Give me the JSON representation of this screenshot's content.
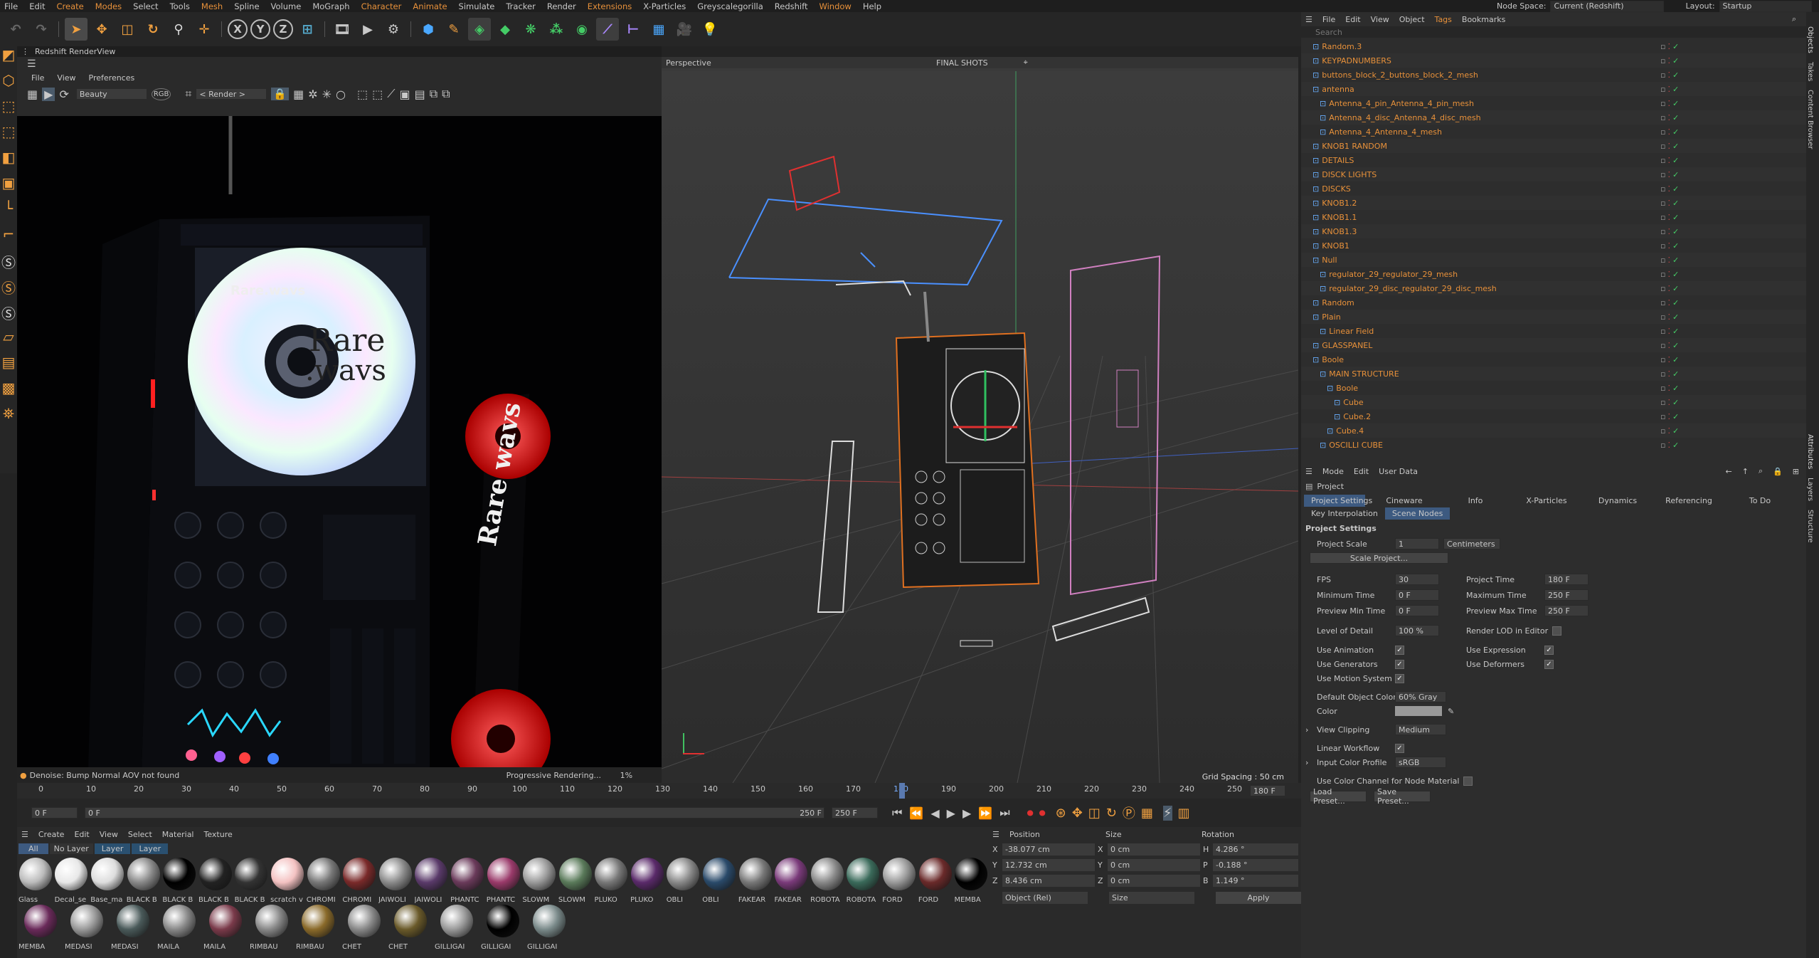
{
  "menubar": {
    "items": [
      "File",
      "Edit",
      "Create",
      "Modes",
      "Select",
      "Tools",
      "Mesh",
      "Spline",
      "Volume",
      "MoGraph",
      "Character",
      "Animate",
      "Simulate",
      "Tracker",
      "Render",
      "Extensions",
      "X-Particles",
      "Greyscalegorilla",
      "Redshift",
      "Window",
      "Help"
    ],
    "node_space_label": "Node Space:",
    "node_space_value": "Current (Redshift)",
    "layout_label": "Layout:",
    "layout_value": "Startup"
  },
  "toolbar": {
    "axis_x": "X",
    "axis_y": "Y",
    "axis_z": "Z"
  },
  "renderview": {
    "title": "Redshift RenderView",
    "menu": [
      "File",
      "View",
      "Preferences"
    ],
    "aov": "Beauty",
    "render_select": "< Render >",
    "status_left": "Denoise: Bump Normal AOV not found",
    "status_mid": "Progressive Rendering...",
    "status_pct": "1%",
    "device_brand": "Rare.wavs",
    "cd_text_1": "Rare",
    "cd_text_2": ".wavs",
    "side_text": "Rare wavs"
  },
  "viewport": {
    "name": "Perspective",
    "camera": "FINAL SHOTS",
    "grid_spacing": "Grid Spacing : 50 cm"
  },
  "objects_panel": {
    "menu": [
      "File",
      "Edit",
      "View",
      "Object",
      "Tags",
      "Bookmarks"
    ],
    "search_placeholder": "Search",
    "items": [
      {
        "name": "Random.3",
        "indent": 1
      },
      {
        "name": "KEYPADNUMBERS",
        "indent": 1
      },
      {
        "name": "buttons_block_2_buttons_block_2_mesh",
        "indent": 1
      },
      {
        "name": "antenna",
        "indent": 1
      },
      {
        "name": "Antenna_4_pin_Antenna_4_pin_mesh",
        "indent": 2
      },
      {
        "name": "Antenna_4_disc_Antenna_4_disc_mesh",
        "indent": 2
      },
      {
        "name": "Antenna_4_Antenna_4_mesh",
        "indent": 2
      },
      {
        "name": "KNOB1 RANDOM",
        "indent": 1
      },
      {
        "name": "DETAILS",
        "indent": 1
      },
      {
        "name": "DISCK LIGHTS",
        "indent": 1
      },
      {
        "name": "DISCKS",
        "indent": 1
      },
      {
        "name": "KNOB1.2",
        "indent": 1
      },
      {
        "name": "KNOB1.1",
        "indent": 1
      },
      {
        "name": "KNOB1.3",
        "indent": 1
      },
      {
        "name": "KNOB1",
        "indent": 1
      },
      {
        "name": "Null",
        "indent": 1
      },
      {
        "name": "regulator_29_regulator_29_mesh",
        "indent": 2
      },
      {
        "name": "regulator_29_disc_regulator_29_disc_mesh",
        "indent": 2
      },
      {
        "name": "Random",
        "indent": 1
      },
      {
        "name": "Plain",
        "indent": 1
      },
      {
        "name": "Linear Field",
        "indent": 2
      },
      {
        "name": "GLASSPANEL",
        "indent": 1
      },
      {
        "name": "Boole",
        "indent": 1
      },
      {
        "name": "MAIN STRUCTURE",
        "indent": 2
      },
      {
        "name": "Boole",
        "indent": 3
      },
      {
        "name": "Cube",
        "indent": 4
      },
      {
        "name": "Cube.2",
        "indent": 4
      },
      {
        "name": "Cube.4",
        "indent": 3
      },
      {
        "name": "OSCILLI CUBE",
        "indent": 2
      }
    ]
  },
  "attributes": {
    "menu": [
      "Mode",
      "Edit",
      "User Data"
    ],
    "title": "Project",
    "tabs": [
      "Project Settings",
      "Cineware",
      "Info",
      "X-Particles",
      "Dynamics",
      "Referencing",
      "To Do"
    ],
    "subtabs": [
      "Key Interpolation",
      "Scene Nodes"
    ],
    "section": "Project Settings",
    "project_scale_label": "Project Scale",
    "project_scale_value": "1",
    "project_scale_unit": "Centimeters",
    "scale_button": "Scale Project...",
    "fps_label": "FPS",
    "fps": "30",
    "project_time_label": "Project Time",
    "project_time": "180 F",
    "min_time_label": "Minimum Time",
    "min_time": "0 F",
    "max_time_label": "Maximum Time",
    "max_time": "250 F",
    "prev_min_label": "Preview Min Time",
    "prev_min": "0 F",
    "prev_max_label": "Preview Max Time",
    "prev_max": "250 F",
    "lod_label": "Level of Detail",
    "lod": "100 %",
    "render_lod_label": "Render LOD in Editor",
    "use_anim": "Use Animation",
    "use_expr": "Use Expression",
    "use_gen": "Use Generators",
    "use_def": "Use Deformers",
    "use_motion": "Use Motion System",
    "def_color_label": "Default Object Color",
    "def_color": "60% Gray",
    "color_label": "Color",
    "view_clip_label": "View Clipping",
    "view_clip": "Medium",
    "linear_label": "Linear Workflow",
    "input_profile_label": "Input Color Profile",
    "input_profile": "sRGB",
    "node_mat_label": "Use Color Channel for Node Material",
    "load_preset": "Load Preset...",
    "save_preset": "Save Preset..."
  },
  "timeline": {
    "ticks": [
      "0",
      "10",
      "20",
      "30",
      "40",
      "50",
      "60",
      "70",
      "80",
      "90",
      "100",
      "110",
      "120",
      "130",
      "140",
      "150",
      "160",
      "170",
      "180",
      "190",
      "200",
      "210",
      "220",
      "230",
      "240",
      "250"
    ],
    "current": "180 F",
    "start": "0 F",
    "start2": "0 F",
    "end": "250 F",
    "end2": "250 F"
  },
  "materials": {
    "menu": [
      "Create",
      "Edit",
      "View",
      "Select",
      "Material",
      "Texture"
    ],
    "filters": [
      "All",
      "No Layer",
      "Layer",
      "Layer"
    ],
    "row1": [
      "Glass",
      "Decal_se",
      "Base_ma",
      "BLACK B",
      "BLACK B",
      "BLACK B",
      "BLACK B",
      "scratch v",
      "CHROMI",
      "CHROMI",
      "JAIWOLI",
      "JAIWOLI",
      "PHANTC",
      "PHANTC",
      "SLOWM",
      "SLOWM",
      "PLUKO",
      "PLUKO",
      "OBLI",
      "OBLI",
      "FAKEAR",
      "FAKEAR",
      "ROBOTA",
      "ROBOTA",
      "FORD",
      "FORD",
      "MEMBA"
    ],
    "row2": [
      "MEMBA",
      "MEDASI",
      "MEDASI",
      "MAILA",
      "MAILA",
      "RIMBAU",
      "RIMBAU",
      "CHET",
      "CHET",
      "GILLIGAI",
      "GILLIGAI",
      "GILLIGAI"
    ]
  },
  "coords": {
    "position": "Position",
    "size": "Size",
    "rotation": "Rotation",
    "px": "-38.077 cm",
    "py": "12.732 cm",
    "pz": "8.436 cm",
    "sx": "0 cm",
    "sy": "0 cm",
    "sz": "0 cm",
    "rh": "4.286 °",
    "rp": "-0.188 °",
    "rb": "1.149 °",
    "mode": "Object (Rel)",
    "size_mode": "Size",
    "apply": "Apply",
    "lx": "X",
    "ly": "Y",
    "lz": "Z",
    "lsx": "X",
    "lsy": "Y",
    "lsz": "Z",
    "lh": "H",
    "lp": "P",
    "lb": "B"
  },
  "right_tabs": [
    "Objects",
    "Takes",
    "Content Browser",
    "Attributes",
    "Layers",
    "Structure"
  ]
}
